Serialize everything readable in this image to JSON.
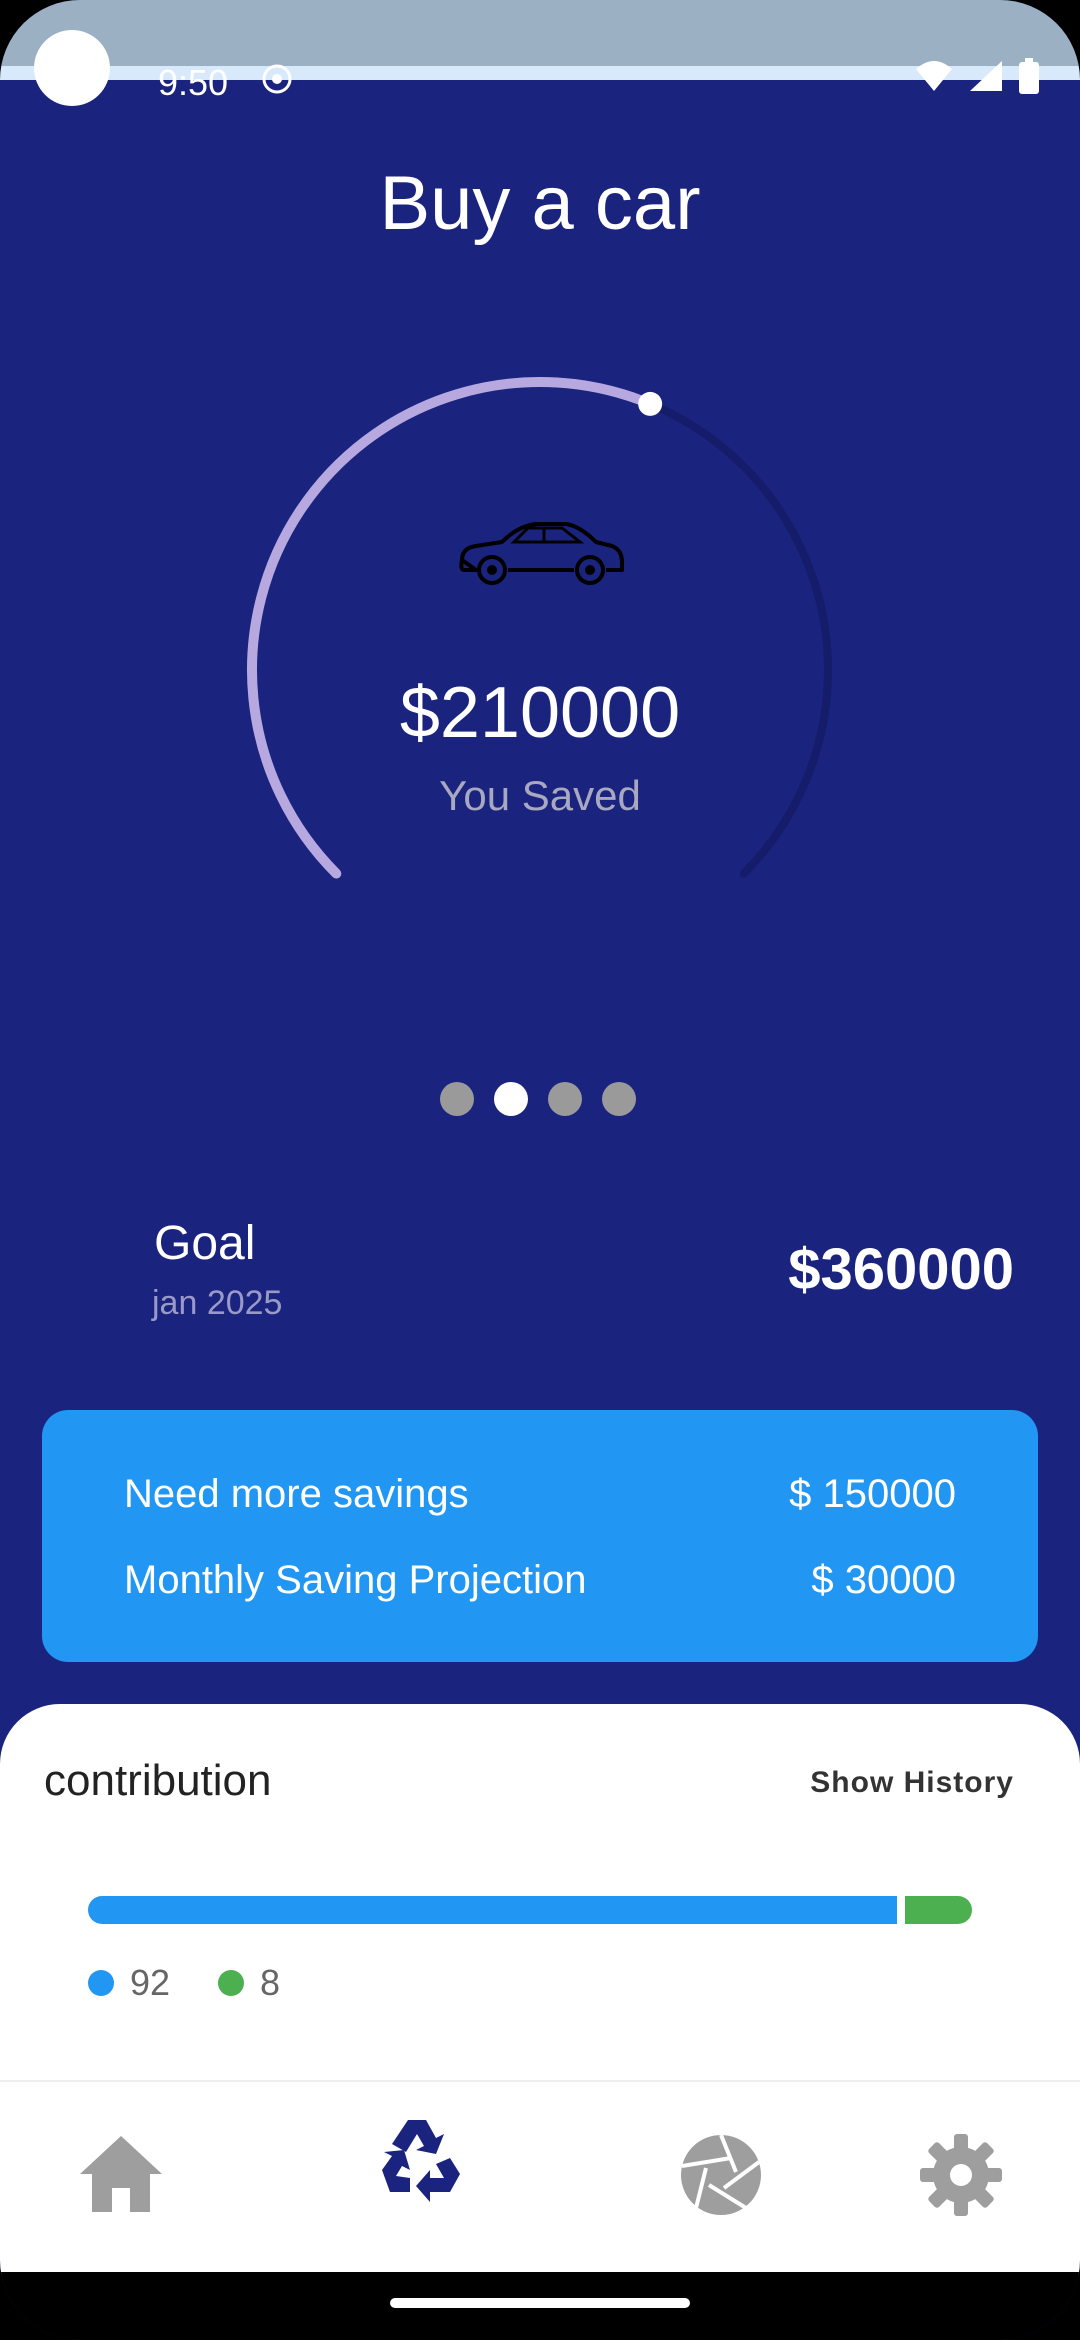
{
  "status_bar": {
    "time": "9:50"
  },
  "header": {
    "title": "Buy a car"
  },
  "saved": {
    "amount": "$210000",
    "label": "You Saved",
    "progress": 0.5833
  },
  "pager": {
    "count": 4,
    "active_index": 1
  },
  "goal": {
    "label": "Goal",
    "date": "jan 2025",
    "amount": "$360000"
  },
  "savings_card": {
    "rows": [
      {
        "label": "Need more savings",
        "value": "$ 150000"
      },
      {
        "label": "Monthly Saving Projection",
        "value": "$ 30000"
      }
    ]
  },
  "contribution": {
    "title": "contribution",
    "history_label": "Show History",
    "segments": [
      {
        "value": 92,
        "color": "#2196f3"
      },
      {
        "value": 8,
        "color": "#4caf50"
      }
    ],
    "legend": [
      {
        "text": "92",
        "color": "#2196f3"
      },
      {
        "text": "8",
        "color": "#4caf50"
      }
    ]
  },
  "nav": [
    {
      "icon": "home-icon",
      "active": false
    },
    {
      "icon": "recycle-icon",
      "active": true
    },
    {
      "icon": "camera-aperture-icon",
      "active": false
    },
    {
      "icon": "gear-icon",
      "active": false
    }
  ],
  "colors": {
    "background": "#1a237e",
    "accent": "#2196f3",
    "ring": "#b7a9e0",
    "green": "#4caf50"
  }
}
